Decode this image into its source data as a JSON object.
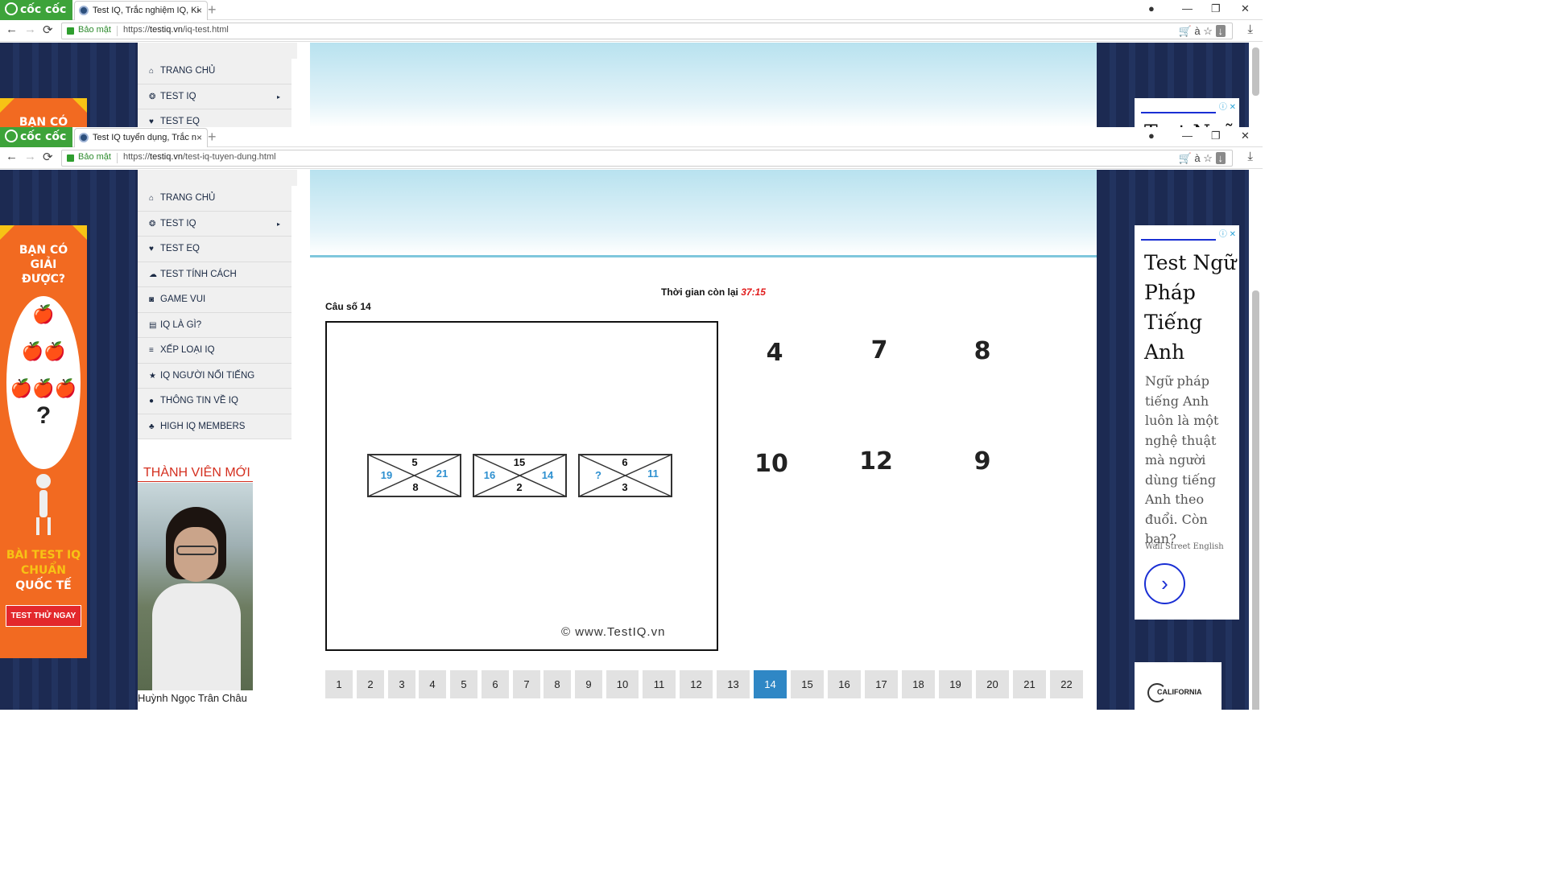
{
  "back_window": {
    "brand": "cốc cốc",
    "tab_title": "Test IQ, Trắc nghiệm IQ, Ki",
    "secure_label": "Bảo mật",
    "url_scheme": "https://",
    "url_host": "testiq.vn",
    "url_path": "/iq-test.html",
    "menu": [
      "TRANG CHỦ",
      "TEST IQ",
      "TEST EQ"
    ],
    "ad_left_text": "BẠN CÓ",
    "ad_right_text": "Test Ngữ"
  },
  "front_window": {
    "brand": "cốc cốc",
    "tab_title": "Test IQ tuyển dụng, Trắc n",
    "secure_label": "Bảo mật",
    "url_scheme": "https://",
    "url_host": "testiq.vn",
    "url_path": "/test-iq-tuyen-dung.html"
  },
  "icons": {
    "back": "←",
    "forward": "→",
    "reload": "⟳",
    "new_tab": "+",
    "close_tab": "×",
    "account": "●",
    "minimize": "—",
    "restore": "❐",
    "close": "✕",
    "cart": "🛒",
    "translate": "à",
    "star": "☆",
    "download_arrow": "↓",
    "download": "⤓",
    "menu_caret": "▸"
  },
  "menu": [
    {
      "label": "TRANG CHỦ",
      "icon": "⌂"
    },
    {
      "label": "TEST IQ",
      "icon": "❂"
    },
    {
      "label": "TEST EQ",
      "icon": "♥"
    },
    {
      "label": "TEST TÍNH CÁCH",
      "icon": "☁"
    },
    {
      "label": "GAME VUI",
      "icon": "◙"
    },
    {
      "label": "IQ LÀ GÌ?",
      "icon": "▤"
    },
    {
      "label": "XẾP LOẠI IQ",
      "icon": "≡"
    },
    {
      "label": "IQ NGƯỜI NỔI TIẾNG",
      "icon": "★"
    },
    {
      "label": "THÔNG TIN VỀ IQ",
      "icon": "●"
    },
    {
      "label": "HIGH IQ MEMBERS",
      "icon": "♣"
    }
  ],
  "ad_left": {
    "question": [
      "BẠN CÓ",
      "GIẢI",
      "ĐƯỢC?"
    ],
    "apples": "🍎",
    "qmark": "?",
    "line1": "BÀI TEST IQ",
    "line2": "CHUẨN",
    "line3": "QUỐC TẾ",
    "cta": "TEST THỬ NGAY"
  },
  "ad_right": {
    "choice": "ⓘ ✕",
    "title": "Test Ngữ Pháp Tiếng Anh",
    "body": "Ngữ pháp tiếng Anh luôn là một nghệ thuật mà người dùng tiếng Anh theo đuổi. Còn bạn?",
    "brand": "Wall Street English",
    "arrow": "›"
  },
  "ad2": {
    "text": "CALIFORNIA"
  },
  "new_members": {
    "title": "THÀNH VIÊN MỚI",
    "name": "Huỳnh Ngọc Trân Châu"
  },
  "quiz": {
    "timer_label": "Thời gian còn lại",
    "timer_value": "37:15",
    "question_label": "Câu số 14",
    "puzzles": [
      {
        "top": "5",
        "left": "19",
        "right": "21",
        "bottom": "8"
      },
      {
        "top": "15",
        "left": "16",
        "right": "14",
        "bottom": "2"
      },
      {
        "top": "6",
        "left": "?",
        "right": "11",
        "bottom": "3"
      }
    ],
    "copyright": "© www.TestIQ.vn",
    "answers": [
      "4",
      "7",
      "8",
      "10",
      "12",
      "9"
    ]
  },
  "pagination": {
    "pages": [
      "1",
      "2",
      "3",
      "4",
      "5",
      "6",
      "7",
      "8",
      "9",
      "10",
      "11",
      "12",
      "13",
      "14",
      "15",
      "16",
      "17",
      "18",
      "19",
      "20",
      "21",
      "22"
    ],
    "active": "14"
  },
  "colors": {
    "brand_green": "#3da33a",
    "accent_blue": "#2f87c5",
    "timer_red": "#e11b1b",
    "puzzle_blue": "#2e90d0",
    "ad_orange": "#f26a21",
    "title_red": "#d42f1f"
  }
}
